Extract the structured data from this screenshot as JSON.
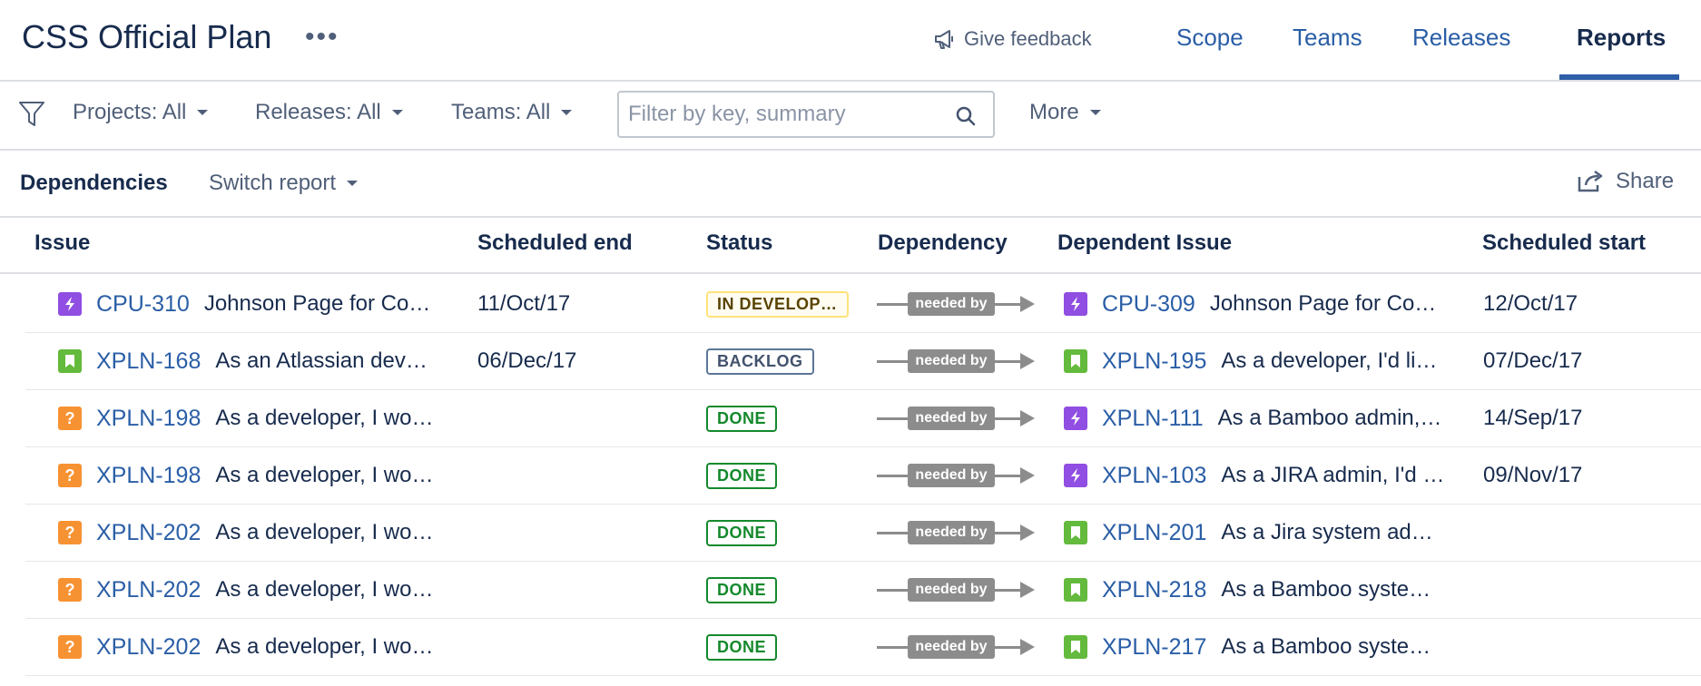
{
  "header": {
    "title": "CSS Official Plan",
    "more_label": "•••",
    "feedback_label": "Give feedback",
    "tabs": [
      {
        "label": "Scope",
        "active": false
      },
      {
        "label": "Teams",
        "active": false
      },
      {
        "label": "Releases",
        "active": false
      },
      {
        "label": "Reports",
        "active": true
      }
    ]
  },
  "filters": {
    "projects": "Projects: All",
    "releases": "Releases: All",
    "teams": "Teams: All",
    "search_placeholder": "Filter by key, summary",
    "more": "More"
  },
  "report": {
    "title": "Dependencies",
    "switch_label": "Switch report",
    "share_label": "Share"
  },
  "table": {
    "columns": [
      "Issue",
      "Scheduled end",
      "Status",
      "Dependency",
      "Dependent Issue",
      "Scheduled start"
    ],
    "dependency_label": "needed by",
    "rows": [
      {
        "issue_type": "epic",
        "issue_key": "CPU-310",
        "issue_summary": "Johnson Page for Co…",
        "scheduled_end": "11/Oct/17",
        "status": "IN DEVELOP…",
        "status_style": "indev",
        "dep_type": "epic",
        "dep_key": "CPU-309",
        "dep_summary": "Johnson Page for Co…",
        "scheduled_start": "12/Oct/17"
      },
      {
        "issue_type": "story",
        "issue_key": "XPLN-168",
        "issue_summary": "As an Atlassian dev…",
        "scheduled_end": "06/Dec/17",
        "status": "BACKLOG",
        "status_style": "backlog",
        "dep_type": "story",
        "dep_key": "XPLN-195",
        "dep_summary": "As a developer, I'd li…",
        "scheduled_start": "07/Dec/17"
      },
      {
        "issue_type": "question",
        "issue_key": "XPLN-198",
        "issue_summary": "As a developer, I wo…",
        "scheduled_end": "",
        "status": "DONE",
        "status_style": "done",
        "dep_type": "epic",
        "dep_key": "XPLN-111",
        "dep_summary": "As a Bamboo admin,…",
        "scheduled_start": "14/Sep/17"
      },
      {
        "issue_type": "question",
        "issue_key": "XPLN-198",
        "issue_summary": "As a developer, I wo…",
        "scheduled_end": "",
        "status": "DONE",
        "status_style": "done",
        "dep_type": "epic",
        "dep_key": "XPLN-103",
        "dep_summary": "As a JIRA admin, I'd …",
        "scheduled_start": "09/Nov/17"
      },
      {
        "issue_type": "question",
        "issue_key": "XPLN-202",
        "issue_summary": "As a developer, I wo…",
        "scheduled_end": "",
        "status": "DONE",
        "status_style": "done",
        "dep_type": "story",
        "dep_key": "XPLN-201",
        "dep_summary": "As a Jira system ad…",
        "scheduled_start": ""
      },
      {
        "issue_type": "question",
        "issue_key": "XPLN-202",
        "issue_summary": "As a developer, I wo…",
        "scheduled_end": "",
        "status": "DONE",
        "status_style": "done",
        "dep_type": "story",
        "dep_key": "XPLN-218",
        "dep_summary": "As a Bamboo syste…",
        "scheduled_start": ""
      },
      {
        "issue_type": "question",
        "issue_key": "XPLN-202",
        "issue_summary": "As a developer, I wo…",
        "scheduled_end": "",
        "status": "DONE",
        "status_style": "done",
        "dep_type": "story",
        "dep_key": "XPLN-217",
        "dep_summary": "As a Bamboo syste…",
        "scheduled_start": ""
      }
    ]
  },
  "colors": {
    "link": "#2a5ea6",
    "text": "#172b4d",
    "epic": "#904ee2",
    "story": "#63ba3c",
    "question": "#f79232",
    "done": "#14892c",
    "in_development": "#594300",
    "backlog": "#42526e",
    "dependency": "#8c8c8c"
  },
  "icons": {
    "epic": "lightning-icon",
    "story": "bookmark-icon",
    "question": "question-icon",
    "filter": "funnel-icon",
    "search": "search-icon",
    "feedback": "megaphone-icon",
    "share": "share-icon"
  }
}
